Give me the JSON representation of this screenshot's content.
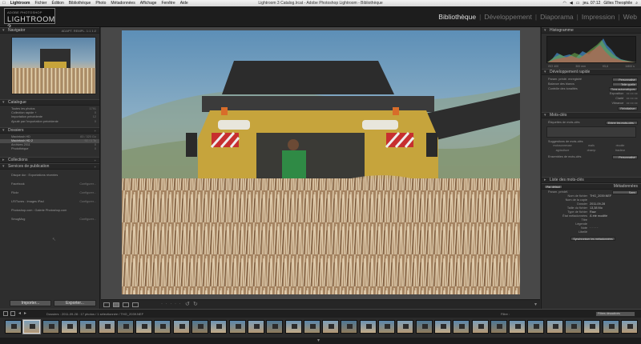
{
  "menubar": {
    "apple": "",
    "items": [
      "Lightroom",
      "Fichier",
      "Édition",
      "Bibliothèque",
      "Photo",
      "Métadonnées",
      "Affichage",
      "Fenêtre",
      "Aide"
    ],
    "window_title": "Lightroom 3 Catalog.lrcat - Adobe Photoshop Lightroom - Bibliothèque",
    "clock": "jeu. 07:12",
    "user": "Gilles Theophile"
  },
  "header": {
    "logo_sub": "ADOBE PHOTOSHOP",
    "logo_main": "LIGHTROOM 3",
    "modules": [
      "Bibliothèque",
      "Développement",
      "Diaporama",
      "Impression",
      "Web"
    ],
    "active_module": "Bibliothèque"
  },
  "left": {
    "navigator": {
      "title": "Navigator",
      "zoom": "ADAPT.   REMPL.   1:1   1:2"
    },
    "catalog": {
      "title": "Catalogue",
      "rows": [
        {
          "label": "Toutes les photos",
          "count": "1791"
        },
        {
          "label": "Collection rapide +",
          "count": "0"
        },
        {
          "label": "Importation précédente",
          "count": "12"
        },
        {
          "label": "Ajouté par l'exportation précédente",
          "count": "0"
        }
      ]
    },
    "folders": {
      "title": "Dossiers",
      "rows": [
        {
          "label": "Macintosh HD",
          "count": "83 / 320 Go"
        },
        {
          "label": "Macintosh HD 2",
          "count": "92 / 1 To"
        },
        {
          "label": "Archives 2011",
          "count": "0"
        },
        {
          "label": "Photothèque",
          "count": "0"
        }
      ]
    },
    "collections": {
      "title": "Collections"
    },
    "publish": {
      "title": "Services de publication",
      "rows": [
        {
          "label": "Disque dur : Exportations récentes",
          "action": ""
        },
        {
          "label": "Facebook",
          "action": "Configurer..."
        },
        {
          "label": "Flickr",
          "action": "Configurer..."
        },
        {
          "label": "LR/Tunes : Images iPad",
          "action": "Configurer..."
        },
        {
          "label": "Photoshop.com : Galerie Photoshop.com",
          "action": ""
        },
        {
          "label": "SmugMug",
          "action": "Configurer..."
        }
      ]
    },
    "import_label": "Importer...",
    "export_label": "Exporter..."
  },
  "right": {
    "histogram": {
      "title": "Histogramme",
      "iso": "ISO 400",
      "focal": "300 mm",
      "aperture": "f/5,6",
      "shutter": "1/800 s"
    },
    "quick_develop": {
      "title": "Développement rapide",
      "preset_label": "Param. prédé. enregistré",
      "preset_value": "Personnalisé",
      "wb_label": "Balance des blancs",
      "wb_value": "Telle quelle",
      "tone_label": "Contrôle des tonalités",
      "tone_button": "Tons automatiques",
      "exposure_label": "Exposition",
      "clarity_label": "Clarté",
      "vibrance_label": "Vibrance",
      "reset_button": "Réinitialiser"
    },
    "keywords": {
      "title": "Mots-clés",
      "tag_label": "Étiquettes de mots-clés",
      "tag_value": "Entrer les mots-clés",
      "suggest_label": "Suggestions de mots-clés",
      "suggestions": [
        "moissonneuse",
        "maïs",
        "récolte",
        "agriculture",
        "champ",
        "tracteur"
      ],
      "set_label": "Ensembles de mots-clés",
      "set_value": "Personnalisé"
    },
    "keyword_list": {
      "title": "Liste des mots-clés"
    },
    "metadata": {
      "title": "Métadonnées",
      "preset_label": "Param. prédéf.",
      "preset_value": "Sans",
      "view_select": "Par défaut",
      "rows": [
        {
          "label": "Nom de fichier",
          "value": "THG_2039.NEF"
        },
        {
          "label": "Nom de la copie",
          "value": ""
        },
        {
          "label": "Dossier",
          "value": "2011-09-28"
        },
        {
          "label": "Taille du fichier",
          "value": "13,38 Mo"
        },
        {
          "label": "Type de fichier",
          "value": "Raw"
        },
        {
          "label": "État métadonnées",
          "value": "À été modifié"
        },
        {
          "label": "Titre",
          "value": ""
        },
        {
          "label": "Légende",
          "value": ""
        },
        {
          "label": "Note",
          "value": "· · · · ·"
        },
        {
          "label": "Libellé",
          "value": ""
        }
      ],
      "sync_button": "Synchroniser les métadonnées"
    }
  },
  "filmstrip_bar": {
    "path": "Dossiers : 2011-09-28 : 17 photos / 1 sélectionnée / THG_2039.NEF",
    "filter_label": "Filtre :",
    "filter_value": "Filtres désactivés"
  },
  "thumb_count": 34
}
